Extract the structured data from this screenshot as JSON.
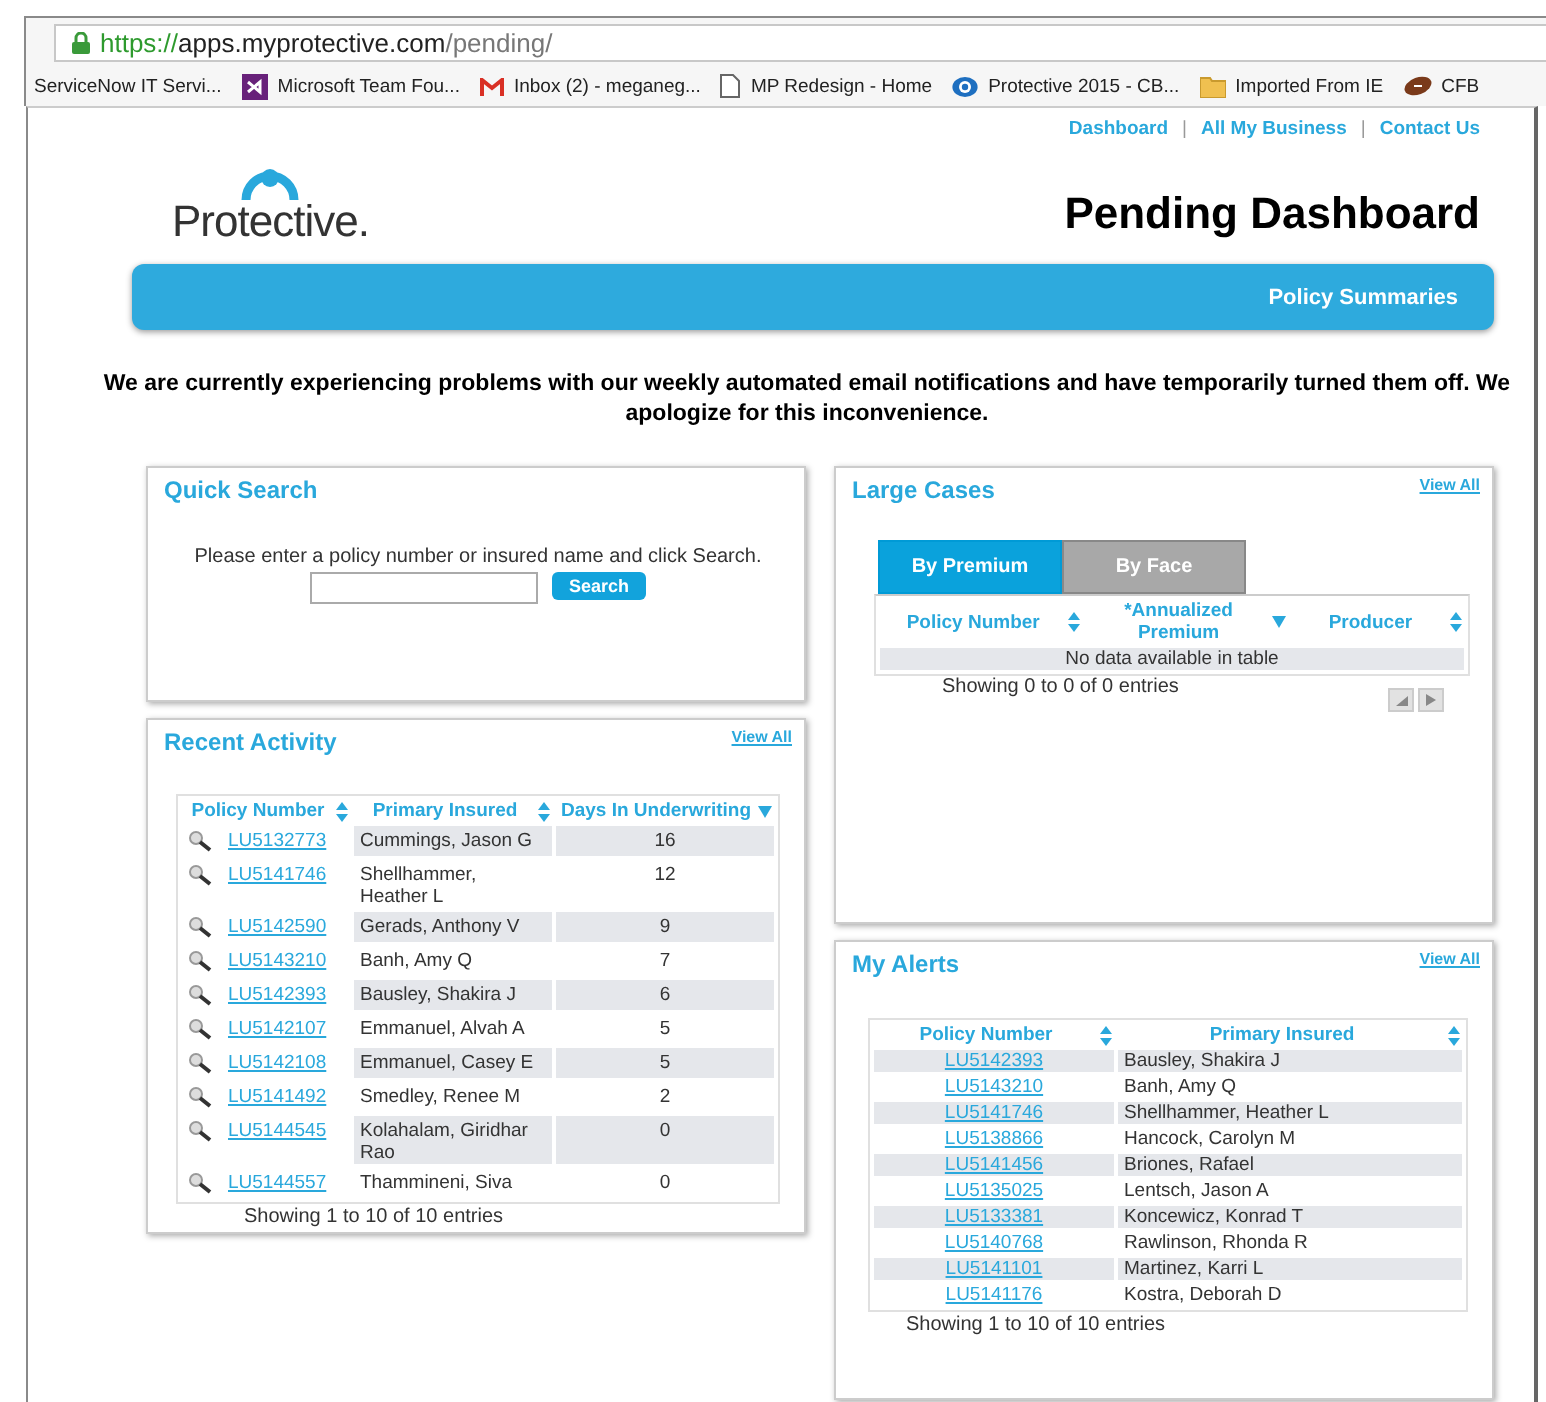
{
  "browser": {
    "url": {
      "scheme": "https://",
      "host": "apps.myprotective.com",
      "path": "/pending/"
    },
    "bookmarks": [
      {
        "kind": "none",
        "label": "ServiceNow IT Servi..."
      },
      {
        "kind": "studio",
        "label": "Microsoft Team Fou..."
      },
      {
        "kind": "mail",
        "label": "Inbox (2) - meganeg..."
      },
      {
        "kind": "page",
        "label": "MP Redesign - Home"
      },
      {
        "kind": "eye",
        "label": "Protective 2015 - CB..."
      },
      {
        "kind": "folder",
        "label": "Imported From IE"
      },
      {
        "kind": "ball",
        "label": "CFB"
      }
    ]
  },
  "top_links": [
    {
      "kind": "link",
      "label": "Dashboard"
    },
    {
      "kind": "separator",
      "label": "|"
    },
    {
      "kind": "link",
      "label": "All My Business"
    },
    {
      "kind": "separator",
      "label": "|"
    },
    {
      "kind": "link",
      "label": "Contact Us"
    }
  ],
  "logo": "Protective.",
  "page_title": "Pending Dashboard",
  "nav_bar": {
    "label": "Policy Summaries"
  },
  "notice": "We are currently experiencing problems with our weekly automated email notifications and have temporarily turned them off. We apologize for this inconvenience.",
  "quick_search": {
    "title": "Quick Search",
    "prompt": "Please enter a policy number or insured name and click Search.",
    "button": "Search"
  },
  "recent_activity": {
    "title": "Recent Activity",
    "view_all": "View All",
    "columns": [
      {
        "label": "Policy Number",
        "sorted_desc": false
      },
      {
        "label": "Primary Insured",
        "sorted_desc": false
      },
      {
        "label": "Days In Underwriting",
        "sorted_desc": true
      }
    ],
    "rows": [
      {
        "policy": "LU5132773",
        "insured": "Cummings, Jason G",
        "days": "16"
      },
      {
        "policy": "LU5141746",
        "insured": "Shellhammer, Heather L",
        "days": "12"
      },
      {
        "policy": "LU5142590",
        "insured": "Gerads, Anthony V",
        "days": "9"
      },
      {
        "policy": "LU5143210",
        "insured": "Banh, Amy Q",
        "days": "7"
      },
      {
        "policy": "LU5142393",
        "insured": "Bausley, Shakira J",
        "days": "6"
      },
      {
        "policy": "LU5142107",
        "insured": "Emmanuel, Alvah A",
        "days": "5"
      },
      {
        "policy": "LU5142108",
        "insured": "Emmanuel, Casey E",
        "days": "5"
      },
      {
        "policy": "LU5141492",
        "insured": "Smedley, Renee M",
        "days": "2"
      },
      {
        "policy": "LU5144545",
        "insured": "Kolahalam, Giridhar Rao",
        "days": "0"
      },
      {
        "policy": "LU5144557",
        "insured": "Thammineni, Siva",
        "days": "0"
      }
    ],
    "info": "Showing 1 to 10 of 10 entries"
  },
  "large_cases": {
    "title": "Large Cases",
    "view_all": "View All",
    "tabs": [
      {
        "label": "By Premium",
        "selected": true
      },
      {
        "label": "By Face",
        "selected": false
      }
    ],
    "columns": [
      {
        "label": "Policy Number",
        "sorted_desc": false
      },
      {
        "label": "*Annualized Premium",
        "sorted_desc": true
      },
      {
        "label": "Producer",
        "sorted_desc": false
      }
    ],
    "empty": "No data available in table",
    "info": "Showing 0 to 0 of 0 entries"
  },
  "my_alerts": {
    "title": "My Alerts",
    "view_all": "View All",
    "columns": [
      {
        "label": "Policy Number",
        "sorted_desc": false
      },
      {
        "label": "Primary Insured",
        "sorted_desc": false
      }
    ],
    "rows": [
      {
        "policy": "LU5142393",
        "insured": "Bausley, Shakira J"
      },
      {
        "policy": "LU5143210",
        "insured": "Banh, Amy Q"
      },
      {
        "policy": "LU5141746",
        "insured": "Shellhammer, Heather L"
      },
      {
        "policy": "LU5138866",
        "insured": "Hancock, Carolyn M"
      },
      {
        "policy": "LU5141456",
        "insured": "Briones, Rafael"
      },
      {
        "policy": "LU5135025",
        "insured": "Lentsch, Jason A"
      },
      {
        "policy": "LU5133381",
        "insured": "Koncewicz, Konrad T"
      },
      {
        "policy": "LU5140768",
        "insured": "Rawlinson, Rhonda R"
      },
      {
        "policy": "LU5141101",
        "insured": "Martinez, Karri L"
      },
      {
        "policy": "LU5141176",
        "insured": "Kostra, Deborah D"
      }
    ],
    "info": "Showing 1 to 10 of 10 entries"
  }
}
